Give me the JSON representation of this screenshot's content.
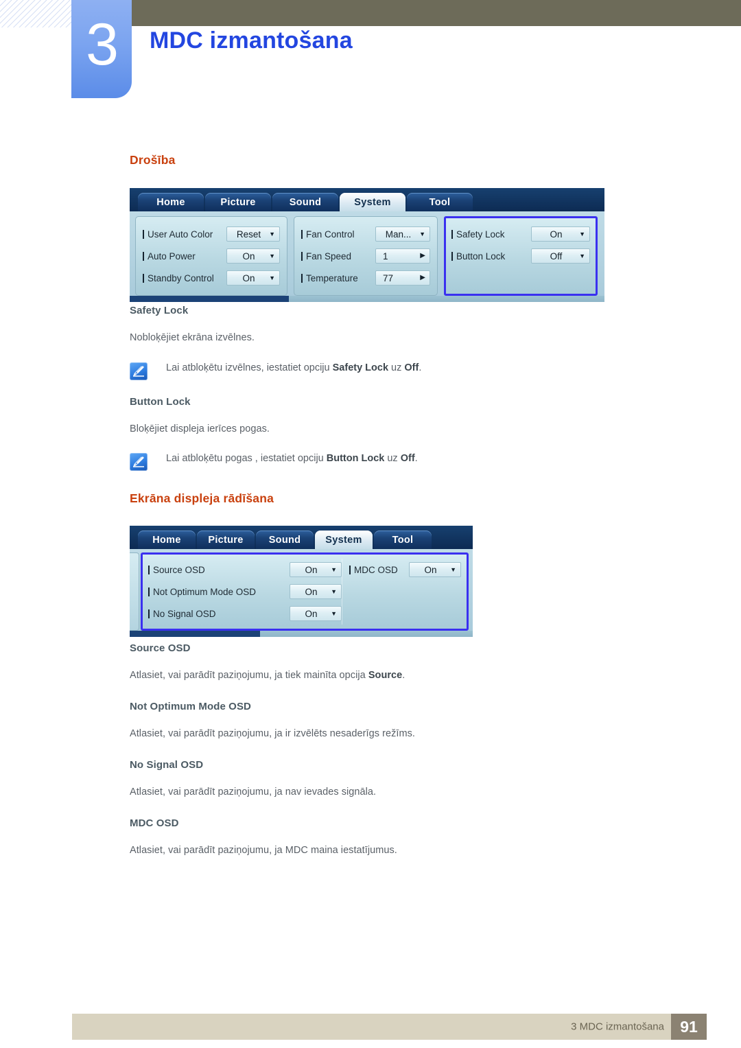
{
  "header": {
    "chapter_number": "3",
    "chapter_title": "MDC izmantošana"
  },
  "sections": [
    {
      "heading": "Drošība",
      "subsections": [
        {
          "title": "Safety Lock",
          "paragraph": "Nobloķējiet ekrāna izvēlnes.",
          "note_prefix": "Lai atbloķētu izvēlnes, iestatiet opciju ",
          "note_bold1": "Safety Lock",
          "note_mid": " uz ",
          "note_bold2": "Off",
          "note_suffix": "."
        },
        {
          "title": "Button Lock",
          "paragraph": "Bloķējiet displeja ierīces pogas.",
          "note_prefix": "Lai atbloķētu pogas , iestatiet opciju ",
          "note_bold1": "Button Lock",
          "note_mid": " uz ",
          "note_bold2": "Off",
          "note_suffix": "."
        }
      ]
    },
    {
      "heading": "Ekrāna displeja rādīšana",
      "subsections": [
        {
          "title": "Source OSD",
          "paragraph_prefix": "Atlasiet, vai parādīt paziņojumu, ja tiek mainīta opcija ",
          "paragraph_bold": "Source",
          "paragraph_suffix": "."
        },
        {
          "title": "Not Optimum Mode OSD",
          "paragraph": "Atlasiet, vai parādīt paziņojumu, ja ir izvēlēts nesaderīgs režīms."
        },
        {
          "title": "No Signal OSD",
          "paragraph": "Atlasiet, vai parādīt paziņojumu, ja nav ievades signāla."
        },
        {
          "title": "MDC OSD",
          "paragraph": "Atlasiet, vai parādīt paziņojumu, ja MDC maina iestatījumus."
        }
      ]
    }
  ],
  "mdc_screenshot_1": {
    "tabs": [
      {
        "label": "Home",
        "active": false
      },
      {
        "label": "Picture",
        "active": false
      },
      {
        "label": "Sound",
        "active": false
      },
      {
        "label": "System",
        "active": true
      },
      {
        "label": "Tool",
        "active": false
      }
    ],
    "panels": [
      {
        "highlight": false,
        "rows": [
          {
            "label": "User Auto Color",
            "value": "Reset",
            "control": "dropdown"
          },
          {
            "label": "Auto Power",
            "value": "On",
            "control": "dropdown"
          },
          {
            "label": "Standby Control",
            "value": "On",
            "control": "dropdown"
          }
        ]
      },
      {
        "highlight": false,
        "rows": [
          {
            "label": "Fan Control",
            "value": "Man...",
            "control": "dropdown"
          },
          {
            "label": "Fan Speed",
            "value": "1",
            "control": "stepper"
          },
          {
            "label": "Temperature",
            "value": "77",
            "control": "stepper"
          }
        ]
      },
      {
        "highlight": true,
        "rows": [
          {
            "label": "Safety Lock",
            "value": "On",
            "control": "dropdown"
          },
          {
            "label": "Button Lock",
            "value": "Off",
            "control": "dropdown"
          }
        ]
      }
    ]
  },
  "mdc_screenshot_2": {
    "tabs": [
      {
        "label": "Home",
        "active": false
      },
      {
        "label": "Picture",
        "active": false
      },
      {
        "label": "Sound",
        "active": false
      },
      {
        "label": "System",
        "active": true
      },
      {
        "label": "Tool",
        "active": false
      }
    ],
    "panels": [
      {
        "highlight": true,
        "rows": [
          {
            "label": "Source OSD",
            "value": "On",
            "control": "dropdown"
          },
          {
            "label": "Not Optimum Mode OSD",
            "value": "On",
            "control": "dropdown"
          },
          {
            "label": "No Signal OSD",
            "value": "On",
            "control": "dropdown"
          }
        ]
      },
      {
        "highlight": false,
        "rows": [
          {
            "label": "MDC OSD",
            "value": "On",
            "control": "dropdown"
          }
        ]
      }
    ]
  },
  "footer": {
    "text": "3 MDC izmantošana",
    "page": "91"
  },
  "colors": {
    "chapter_title": "#2346e0",
    "section_heading": "#c9410f",
    "subsection_heading": "#4b5a63",
    "body_text": "#5a6067",
    "header_bar": "#6d6b59",
    "footer_bar": "#d9d3c0",
    "footer_page_bg": "#8b8272",
    "highlight_border": "#3a30f0"
  }
}
